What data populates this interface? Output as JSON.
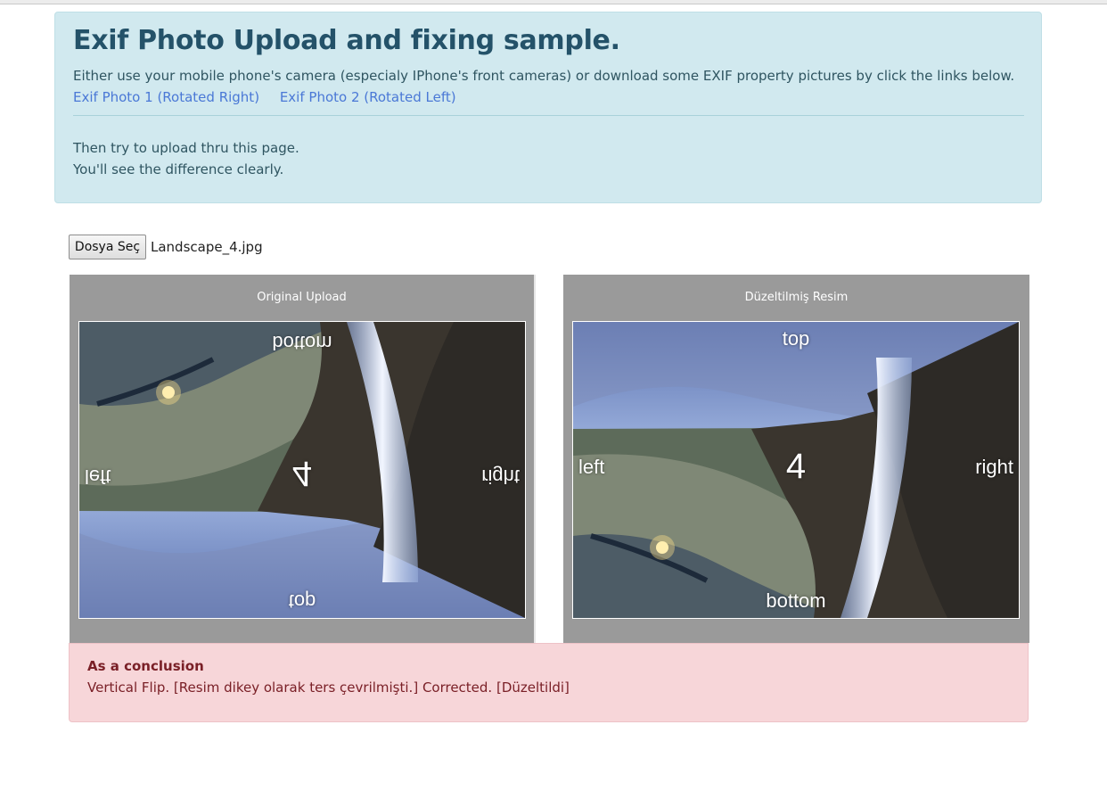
{
  "header": {
    "title": "Exif Photo Upload and fixing sample.",
    "intro": "Either use your mobile phone's camera (especialy IPhone's front cameras) or download some EXIF property pictures by click the links below.",
    "links": [
      "Exif Photo 1 (Rotated Right)",
      "Exif Photo 2 (Rotated Left)"
    ],
    "instruction_1": "Then try to upload thru this page.",
    "instruction_2": "You'll see the difference clearly."
  },
  "file_input": {
    "button_label": "Dosya Seç",
    "selected_file": "Landscape_4.jpg"
  },
  "panels": {
    "original": {
      "title": "Original Upload",
      "labels": {
        "top": "top",
        "bottom": "bottom",
        "left": "left",
        "right": "right",
        "center": "4"
      },
      "transform": "vertical-flip"
    },
    "fixed": {
      "title": "Düzeltilmiş Resim",
      "labels": {
        "top": "top",
        "bottom": "bottom",
        "left": "left",
        "right": "right",
        "center": "4"
      },
      "transform": "none"
    }
  },
  "conclusion": {
    "title": "As a conclusion",
    "text": "Vertical Flip. [Resim dikey olarak ters çevrilmişti.] Corrected. [Düzeltildi]"
  },
  "colors": {
    "jumbotron_bg": "#d1e9ef",
    "link": "#4a78d6",
    "panel_bg": "#9a9a9a",
    "alert_bg": "#f7d6d9",
    "alert_text": "#7a2027"
  }
}
